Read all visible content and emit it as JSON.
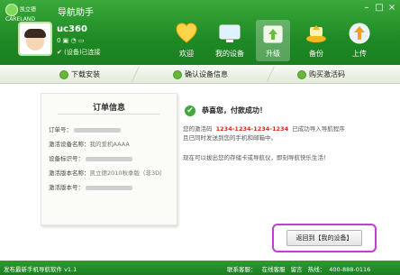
{
  "app": {
    "logo_text": "凯立德",
    "logo_sub": "CARELAND",
    "title": "导航助手"
  },
  "window_controls": {
    "minimize": "–",
    "maximize": "□",
    "close": "×"
  },
  "user": {
    "name": "uc360",
    "meta": "0 ▣ ◔ ▭",
    "status": "(设备)已连接"
  },
  "nav": [
    {
      "label": "欢迎",
      "icon": "heart-icon"
    },
    {
      "label": "我的设备",
      "icon": "monitor-icon"
    },
    {
      "label": "升级",
      "icon": "upgrade-icon",
      "active": true
    },
    {
      "label": "备份",
      "icon": "backup-icon"
    },
    {
      "label": "上传",
      "icon": "upload-icon"
    }
  ],
  "steps": [
    "下载安装",
    "确认设备信息",
    "购买激活码"
  ],
  "order": {
    "title": "订单信息",
    "rows": [
      {
        "label": "订单号：",
        "value": ""
      },
      {
        "label": "激活设备名称：",
        "value": "我的爱机AAAA"
      },
      {
        "label": "设备标识号：",
        "value": ""
      },
      {
        "label": "激活版本名称：",
        "value": "凯立德2010秋季版（非3D）"
      },
      {
        "label": "激活版本号：",
        "value": ""
      }
    ]
  },
  "success": {
    "title": "恭喜您，付款成功！",
    "line1_prefix": "您的激活码",
    "code": "1234-1234-1234-1234",
    "line1_suffix": "已成功导入导航程序",
    "line2": "且已同时发送到您的手机和邮箱中。",
    "line3": "现在可以拔出您的存储卡或导航仪，即刻导航快乐生活！"
  },
  "back_button": "返回到【我的设备】",
  "footer": {
    "left": "发布最新手机导航软件 v1.1",
    "contact_label": "联系客服：",
    "online": "在线客服",
    "guestbook": "留言",
    "phone_label": "热线：",
    "phone": "400-888-0116"
  }
}
